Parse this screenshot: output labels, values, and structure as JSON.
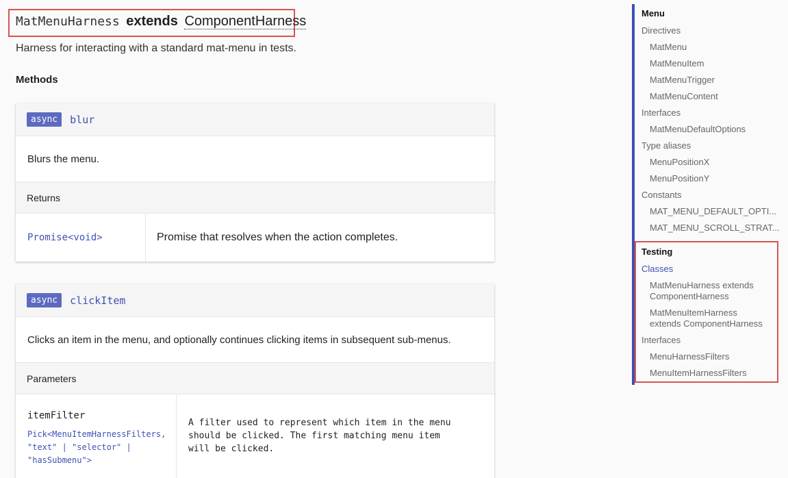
{
  "header": {
    "class_name": "MatMenuHarness",
    "extends_kw": "extends",
    "base_class": "ComponentHarness",
    "description": "Harness for interacting with a standard mat-menu in tests.",
    "methods_heading": "Methods"
  },
  "methods": [
    {
      "badge": "async",
      "name": "blur",
      "description": "Blurs the menu.",
      "returns_label": "Returns",
      "return_type": "Promise<void>",
      "return_desc": "Promise that resolves when the action completes."
    },
    {
      "badge": "async",
      "name": "clickItem",
      "description": "Clicks an item in the menu, and optionally continues clicking items in subsequent sub-menus.",
      "params_label": "Parameters",
      "param_name": "itemFilter",
      "param_type_lines": [
        "Pick<MenuItemHarnessFilters,",
        "\"text\" | \"selector\" |",
        "\"hasSubmenu\">"
      ],
      "param_desc_lines": [
        "A filter used to represent which item in the menu",
        "should be clicked. The first matching menu item",
        "will be clicked."
      ]
    }
  ],
  "sidebar": {
    "menu": "Menu",
    "directives": "Directives",
    "directive_items": [
      "MatMenu",
      "MatMenuItem",
      "MatMenuTrigger",
      "MatMenuContent"
    ],
    "interfaces": "Interfaces",
    "interface_items": [
      "MatMenuDefaultOptions"
    ],
    "type_aliases": "Type aliases",
    "type_alias_items": [
      "MenuPositionX",
      "MenuPositionY"
    ],
    "constants": "Constants",
    "constant_items": [
      "MAT_MENU_DEFAULT_OPTI...",
      "MAT_MENU_SCROLL_STRAT..."
    ],
    "testing": "Testing",
    "classes": "Classes",
    "class_items": [
      [
        "MatMenuHarness extends",
        "ComponentHarness"
      ],
      [
        "MatMenuItemHarness",
        "extends ComponentHarness"
      ]
    ],
    "testing_interfaces": "Interfaces",
    "testing_interface_items": [
      "MenuHarnessFilters",
      "MenuItemHarnessFilters"
    ]
  }
}
